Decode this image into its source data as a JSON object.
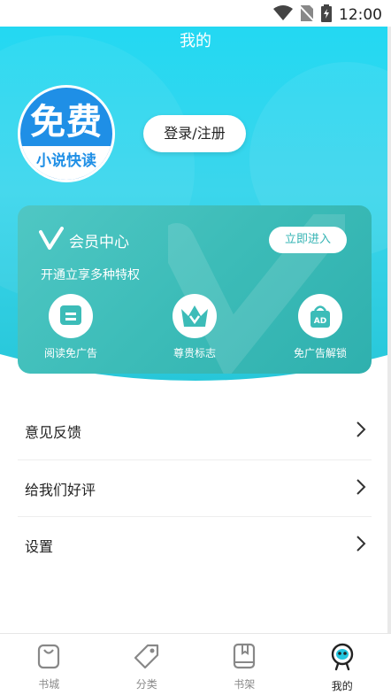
{
  "status_bar": {
    "time": "12:00",
    "icons": [
      "wifi-icon",
      "no-sim-icon",
      "battery-charging-icon"
    ]
  },
  "header": {
    "title": "我的"
  },
  "profile": {
    "logo_top": "免费",
    "logo_bottom": "小说快读",
    "login_label": "登录/注册"
  },
  "vip": {
    "title": "会员中心",
    "subtitle": "开通立享多种特权",
    "enter_label": "立即进入",
    "perks": [
      {
        "label": "阅读免广告",
        "icon": "ad-free-reading-icon"
      },
      {
        "label": "尊贵标志",
        "icon": "crown-icon"
      },
      {
        "label": "免广告解锁",
        "icon": "ad-unlock-bag-icon"
      }
    ]
  },
  "menu": {
    "items": [
      {
        "label": "意见反馈"
      },
      {
        "label": "给我们好评"
      },
      {
        "label": "设置"
      }
    ]
  },
  "tabbar": {
    "items": [
      {
        "label": "书城",
        "icon": "bookstore-icon",
        "active": false
      },
      {
        "label": "分类",
        "icon": "category-tag-icon",
        "active": false
      },
      {
        "label": "书架",
        "icon": "bookshelf-icon",
        "active": false
      },
      {
        "label": "我的",
        "icon": "profile-robot-icon",
        "active": true
      }
    ]
  },
  "colors": {
    "header_accent": "#23d8f2",
    "vip_card": "#3cbcb8",
    "logo_blue": "#1f8fe6"
  }
}
